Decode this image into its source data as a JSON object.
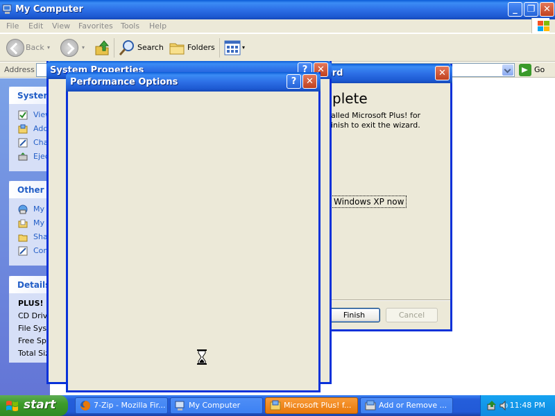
{
  "explorer": {
    "title": "My Computer",
    "menu": [
      "File",
      "Edit",
      "View",
      "Favorites",
      "Tools",
      "Help"
    ],
    "toolbar": {
      "back": "Back",
      "search": "Search",
      "folders": "Folders"
    },
    "address_label": "Address",
    "go_label": "Go",
    "tasks": {
      "system_heading": "System",
      "system_items": [
        "View",
        "Add",
        "Cha",
        "Ejec"
      ],
      "other_heading": "Other P",
      "other_items": [
        "My",
        "My",
        "Sha",
        "Con"
      ],
      "details_heading": "Details",
      "details_lines": [
        "PLUS! (",
        "CD Drive",
        "File Syst",
        "Free Spa",
        "Total Siz"
      ]
    }
  },
  "wizard": {
    "title": "ard",
    "heading": "plete",
    "desc": "alled Microsoft Plus! for\ninish to exit the wizard.",
    "option": "Windows XP now",
    "finish": "Finish",
    "cancel": "Cancel"
  },
  "system_properties": {
    "title": "System Properties"
  },
  "performance_options": {
    "title": "Performance Options"
  },
  "taskbar": {
    "start": "start",
    "items": [
      {
        "label": "7-Zip - Mozilla Fir...",
        "icon": "firefox-icon"
      },
      {
        "label": "My Computer",
        "icon": "computer-icon"
      },
      {
        "label": "Microsoft Plus! f...",
        "icon": "setup-icon"
      },
      {
        "label": "Add or Remove ...",
        "icon": "add-remove-icon"
      }
    ],
    "clock": "11:48 PM"
  }
}
